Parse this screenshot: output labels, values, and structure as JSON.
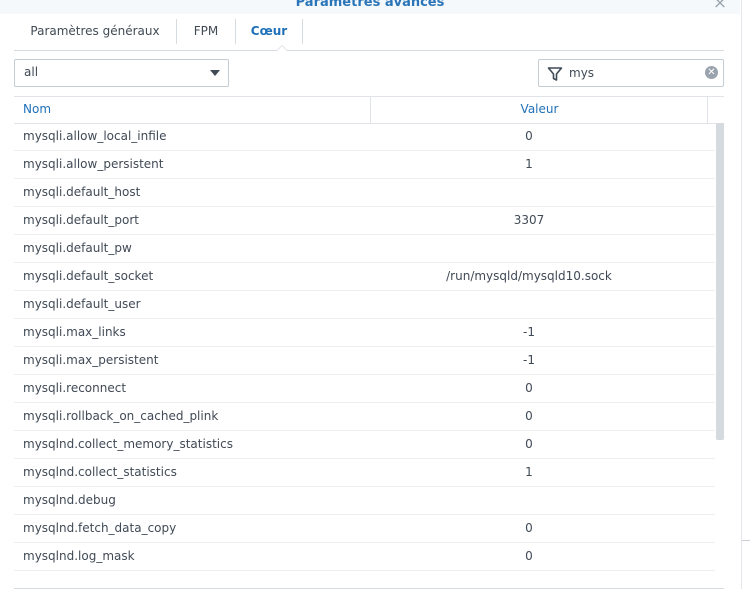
{
  "window": {
    "title": "Paramètres avancés",
    "close_symbol": "×"
  },
  "tabs": [
    {
      "label": "Paramètres généraux",
      "active": false
    },
    {
      "label": "FPM",
      "active": false
    },
    {
      "label": "Cœur",
      "active": true
    }
  ],
  "filter": {
    "category_selected": "all",
    "search_value": "mys",
    "clear_symbol": "✕"
  },
  "table": {
    "columns": [
      "Nom",
      "Valeur"
    ],
    "rows": [
      {
        "name": "mysqli.allow_local_infile",
        "value": "0"
      },
      {
        "name": "mysqli.allow_persistent",
        "value": "1"
      },
      {
        "name": "mysqli.default_host",
        "value": ""
      },
      {
        "name": "mysqli.default_port",
        "value": "3307"
      },
      {
        "name": "mysqli.default_pw",
        "value": ""
      },
      {
        "name": "mysqli.default_socket",
        "value": "/run/mysqld/mysqld10.sock"
      },
      {
        "name": "mysqli.default_user",
        "value": ""
      },
      {
        "name": "mysqli.max_links",
        "value": "-1"
      },
      {
        "name": "mysqli.max_persistent",
        "value": "-1"
      },
      {
        "name": "mysqli.reconnect",
        "value": "0"
      },
      {
        "name": "mysqli.rollback_on_cached_plink",
        "value": "0"
      },
      {
        "name": "mysqlnd.collect_memory_statistics",
        "value": "0"
      },
      {
        "name": "mysqlnd.collect_statistics",
        "value": "1"
      },
      {
        "name": "mysqlnd.debug",
        "value": ""
      },
      {
        "name": "mysqlnd.fetch_data_copy",
        "value": "0"
      },
      {
        "name": "mysqlnd.log_mask",
        "value": "0"
      }
    ]
  },
  "colors": {
    "accent": "#1f70b8",
    "text": "#404a56",
    "border": "#d6dbe0"
  }
}
